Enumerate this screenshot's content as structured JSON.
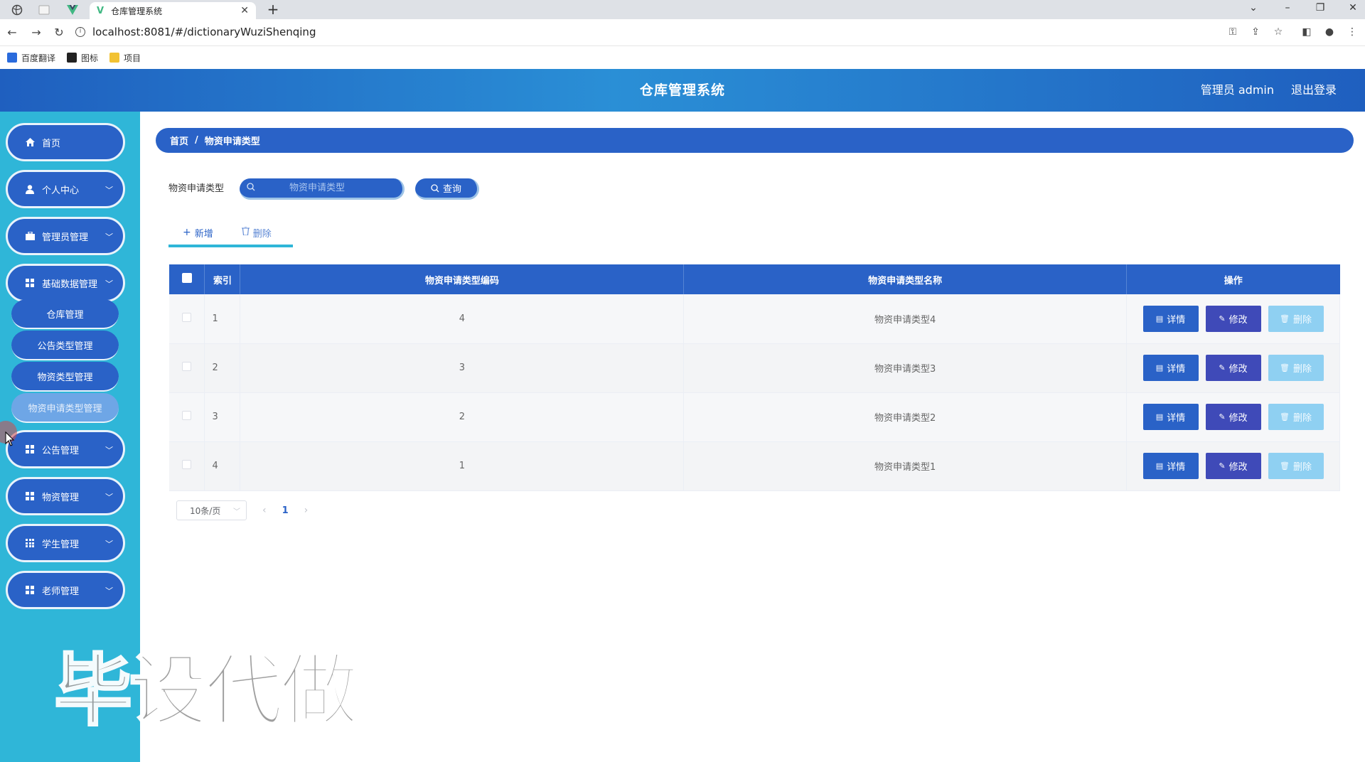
{
  "browser": {
    "tab_title": "仓库管理系统",
    "url": "localhost:8081/#/dictionaryWuziShenqing",
    "bookmarks": [
      {
        "label": "百度翻译",
        "color": "#2a6bdc"
      },
      {
        "label": "图标",
        "color": "#222222"
      },
      {
        "label": "项目",
        "color": "#f2c233"
      }
    ]
  },
  "header": {
    "title": "仓库管理系统",
    "user": "管理员 admin",
    "logout": "退出登录"
  },
  "sidebar": {
    "items": [
      {
        "label": "首页",
        "icon": "home-icon"
      },
      {
        "label": "个人中心",
        "icon": "user-icon"
      },
      {
        "label": "管理员管理",
        "icon": "briefcase-icon"
      },
      {
        "label": "基础数据管理",
        "icon": "grid-icon"
      },
      {
        "label": "公告管理",
        "icon": "grid-icon"
      },
      {
        "label": "物资管理",
        "icon": "grid-icon"
      },
      {
        "label": "学生管理",
        "icon": "grid9-icon"
      },
      {
        "label": "老师管理",
        "icon": "grid-icon"
      }
    ],
    "subitems": [
      {
        "label": "仓库管理"
      },
      {
        "label": "公告类型管理"
      },
      {
        "label": "物资类型管理"
      },
      {
        "label": "物资申请类型管理",
        "active": true
      }
    ]
  },
  "watermark": "毕设代做",
  "breadcrumb": {
    "home": "首页",
    "sep": "/",
    "current": "物资申请类型"
  },
  "search": {
    "label": "物资申请类型",
    "placeholder": "物资申请类型",
    "query_label": "查询"
  },
  "actions": {
    "add_label": "新增",
    "delete_label": "删除"
  },
  "table": {
    "columns": [
      "索引",
      "物资申请类型编码",
      "物资申请类型名称",
      "操作"
    ],
    "rows": [
      {
        "index": "1",
        "code": "4",
        "name": "物资申请类型4"
      },
      {
        "index": "2",
        "code": "3",
        "name": "物资申请类型3"
      },
      {
        "index": "3",
        "code": "2",
        "name": "物资申请类型2"
      },
      {
        "index": "4",
        "code": "1",
        "name": "物资申请类型1"
      }
    ],
    "op_labels": {
      "detail": "详情",
      "edit": "修改",
      "remove": "删除"
    }
  },
  "pagination": {
    "page_size": "10条/页",
    "current_page": "1"
  },
  "colors": {
    "primary": "#2a62c7",
    "sidebar": "#2fb6d8",
    "edit": "#3f4ab8",
    "remove": "#8fd0f2"
  }
}
